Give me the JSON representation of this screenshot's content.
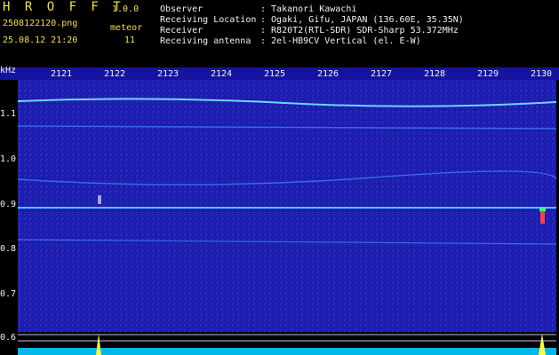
{
  "header": {
    "brand": "H R O F F T",
    "version": "1.0.0",
    "filename": "2508122120.png",
    "datetime": "25.08.12 21:20",
    "meteor_label": "meteor",
    "meteor_count": "11",
    "rows": [
      {
        "label": "Observer",
        "value": ": Takanori Kawachi"
      },
      {
        "label": "Receiving Location",
        "value": ": Ogaki, Gifu, JAPAN (136.60E, 35.35N)"
      },
      {
        "label": "Receiver",
        "value": ": R820T2(RTL-SDR) SDR-Sharp 53.372MHz"
      },
      {
        "label": "Receiving antenna",
        "value": ": 2el-HB9CV Vertical (el. E-W)"
      }
    ]
  },
  "axis": {
    "unit": "kHz",
    "time_ticks": [
      "2121",
      "2122",
      "2123",
      "2124",
      "2125",
      "2126",
      "2127",
      "2128",
      "2129",
      "2130"
    ],
    "freq_ticks": [
      "1.1",
      "1.0",
      "0.9",
      "0.8",
      "0.7",
      "0.6"
    ]
  },
  "colors": {
    "background": "#1a1aa8",
    "signal_line": "#4fc3ff",
    "yellow_text": "#f0e040",
    "meteor_echo": "#ff4040",
    "bottom_trace": "#00d8ff",
    "peak": "#ffff40"
  }
}
